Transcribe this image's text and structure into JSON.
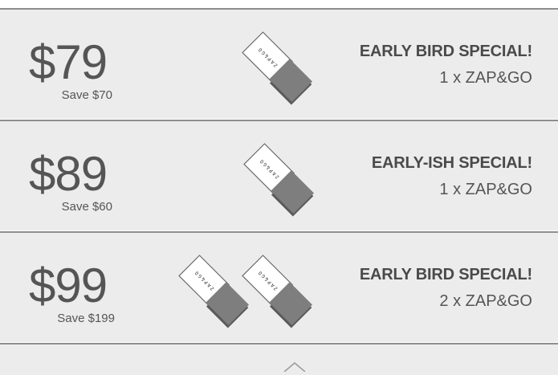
{
  "offers": [
    {
      "price": "$79",
      "save": "Save $70",
      "title": "EARLY BIRD SPECIAL!",
      "qty": "1 x ZAP&GO",
      "device_count": 1
    },
    {
      "price": "$89",
      "save": "Save $60",
      "title": "EARLY-ISH SPECIAL!",
      "qty": "1 x ZAP&GO",
      "device_count": 1
    },
    {
      "price": "$99",
      "save": "Save $199",
      "title": "EARLY BIRD SPECIAL!",
      "qty": "2 x ZAP&GO",
      "device_count": 2
    }
  ],
  "device": {
    "label": "ZAP&GO",
    "icon": "zapgo-device-icon",
    "body_color": "#7e7e7e",
    "shadow_color": "#5a5a5a",
    "label_color": "#ffffff"
  },
  "colors": {
    "panel": "#ececec",
    "divider": "#8e8e8e",
    "text": "#555555"
  }
}
